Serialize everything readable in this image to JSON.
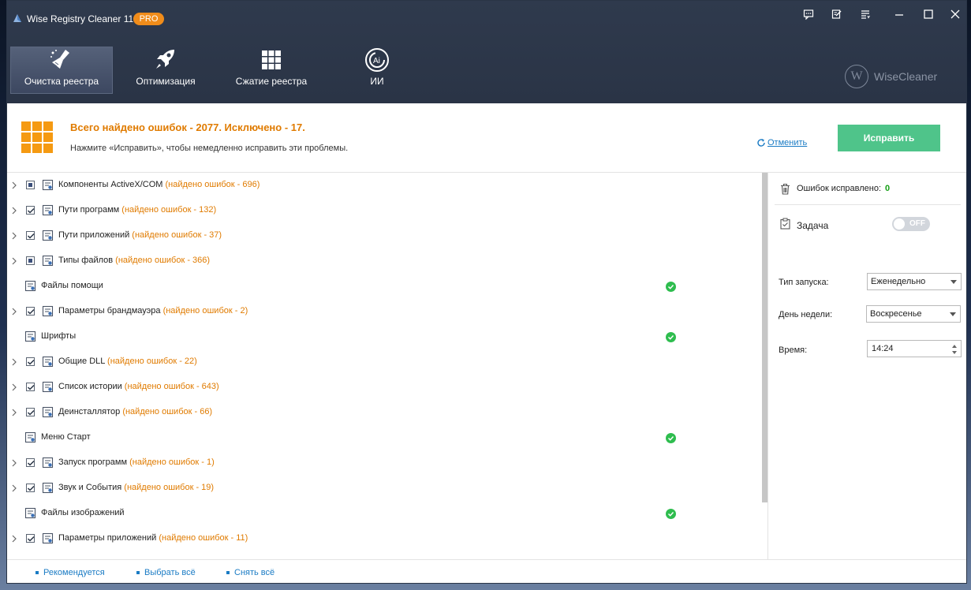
{
  "window": {
    "title": "Wise Registry Cleaner 11",
    "badge": "PRO"
  },
  "titlebar_buttons": [
    "feedback-icon",
    "edit-icon",
    "menu-icon",
    "minimize-icon",
    "maximize-icon",
    "close-icon"
  ],
  "nav": {
    "tabs": [
      {
        "label": "Очистка реестра",
        "icon": "broom-icon",
        "active": true
      },
      {
        "label": "Оптимизация",
        "icon": "rocket-icon",
        "active": false
      },
      {
        "label": "Сжатие реестра",
        "icon": "grid-icon",
        "active": false
      },
      {
        "label": "ИИ",
        "icon": "ai-icon",
        "active": false
      }
    ],
    "brand": "WiseCleaner",
    "brand_letter": "W"
  },
  "summary": {
    "title": "Всего найдено ошибок - 2077. Исключено - 17.",
    "subtitle": "Нажмите «Исправить», чтобы немедленно исправить эти проблемы.",
    "undo_label": "Отменить",
    "fix_label": "Исправить"
  },
  "colors": {
    "accent_orange": "#e07b00",
    "fix_green": "#4fc48a",
    "ok_green": "#2ebd4e",
    "link_blue": "#1a7bc4"
  },
  "items": [
    {
      "name": "Компоненты ActiveX/COM",
      "count": "(найдено ошибок - 696)",
      "expandable": true,
      "check": "partial",
      "ok": false
    },
    {
      "name": "Пути программ",
      "count": "(найдено ошибок - 132)",
      "expandable": true,
      "check": "checked",
      "ok": false
    },
    {
      "name": "Пути приложений",
      "count": "(найдено ошибок - 37)",
      "expandable": true,
      "check": "checked",
      "ok": false
    },
    {
      "name": "Типы файлов",
      "count": "(найдено ошибок - 366)",
      "expandable": true,
      "check": "partial",
      "ok": false
    },
    {
      "name": "Файлы помощи",
      "count": "",
      "expandable": false,
      "check": "none",
      "ok": true
    },
    {
      "name": "Параметры брандмауэра",
      "count": "(найдено ошибок - 2)",
      "expandable": true,
      "check": "checked",
      "ok": false
    },
    {
      "name": "Шрифты",
      "count": "",
      "expandable": false,
      "check": "none",
      "ok": true
    },
    {
      "name": "Общие DLL",
      "count": "(найдено ошибок - 22)",
      "expandable": true,
      "check": "checked",
      "ok": false
    },
    {
      "name": "Список истории",
      "count": "(найдено ошибок - 643)",
      "expandable": true,
      "check": "checked",
      "ok": false
    },
    {
      "name": "Деинсталлятор",
      "count": "(найдено ошибок - 66)",
      "expandable": true,
      "check": "checked",
      "ok": false
    },
    {
      "name": "Меню Старт",
      "count": "",
      "expandable": false,
      "check": "none",
      "ok": true
    },
    {
      "name": "Запуск программ",
      "count": "(найдено ошибок - 1)",
      "expandable": true,
      "check": "checked",
      "ok": false
    },
    {
      "name": "Звук и События",
      "count": "(найдено ошибок - 19)",
      "expandable": true,
      "check": "checked",
      "ok": false
    },
    {
      "name": "Файлы изображений",
      "count": "",
      "expandable": false,
      "check": "none",
      "ok": true
    },
    {
      "name": "Параметры приложений",
      "count": "(найдено ошибок - 11)",
      "expandable": true,
      "check": "checked",
      "ok": false
    }
  ],
  "right_panel": {
    "fixed_label": "Ошибок исправлено:",
    "fixed_value": "0",
    "task_label": "Задача",
    "toggle_label": "OFF",
    "run_type_label": "Тип запуска:",
    "run_type_value": "Еженедельно",
    "weekday_label": "День недели:",
    "weekday_value": "Воскресенье",
    "time_label": "Время:",
    "time_value": "14:24"
  },
  "footer": {
    "recommended": "Рекомендуется",
    "select_all": "Выбрать всё",
    "deselect_all": "Снять всё"
  }
}
